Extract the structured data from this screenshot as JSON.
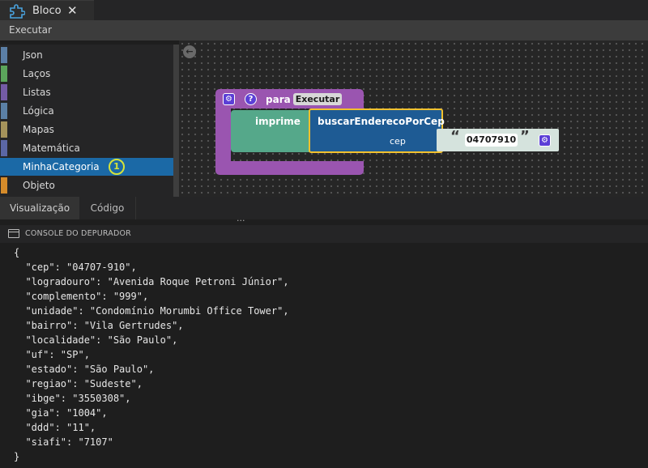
{
  "tab": {
    "title": "Bloco",
    "close_glyph": "✕",
    "icon": "puzzle-icon"
  },
  "toolbar": {
    "run_label": "Executar"
  },
  "toolbox": {
    "categories": [
      {
        "label": "Json",
        "color": "#5b7fa6"
      },
      {
        "label": "Laços",
        "color": "#5ba55b"
      },
      {
        "label": "Listas",
        "color": "#745ba5"
      },
      {
        "label": "Lógica",
        "color": "#5b80a5"
      },
      {
        "label": "Mapas",
        "color": "#a5935b"
      },
      {
        "label": "Matemática",
        "color": "#5b67a5"
      },
      {
        "label": "MinhaCategoria",
        "color": "#1b69a6",
        "selected": true,
        "badge": "1"
      },
      {
        "label": "Objeto",
        "color": "#d58b2a"
      }
    ]
  },
  "workspace": {
    "back_glyph": "←",
    "proc_block": {
      "keyword": "para",
      "name": "Executar",
      "gear_icon": "⚙",
      "help_icon": "?",
      "color": "#9a55b0"
    },
    "print_block": {
      "label": "imprime",
      "color": "#55a88a"
    },
    "call_block": {
      "label": "buscarEnderecoPorCep",
      "param": "cep",
      "color": "#1e5b94",
      "highlight": "#f2c12e"
    },
    "text_block": {
      "open_quote": "“",
      "close_quote": "”",
      "value": "04707910",
      "gear_icon": "⚙"
    }
  },
  "bottom_tabs": {
    "tabs": [
      "Visualização",
      "Código"
    ],
    "active": 0,
    "splitter": "..."
  },
  "console": {
    "title": "CONSOLE DO DEPURADOR",
    "lines": [
      "{",
      "  \"cep\": \"04707-910\",",
      "  \"logradouro\": \"Avenida Roque Petroni Júnior\",",
      "  \"complemento\": \"999\",",
      "  \"unidade\": \"Condomínio Morumbi Office Tower\",",
      "  \"bairro\": \"Vila Gertrudes\",",
      "  \"localidade\": \"São Paulo\",",
      "  \"uf\": \"SP\",",
      "  \"estado\": \"São Paulo\",",
      "  \"regiao\": \"Sudeste\",",
      "  \"ibge\": \"3550308\",",
      "  \"gia\": \"1004\",",
      "  \"ddd\": \"11\",",
      "  \"siafi\": \"7107\"",
      "}"
    ]
  }
}
